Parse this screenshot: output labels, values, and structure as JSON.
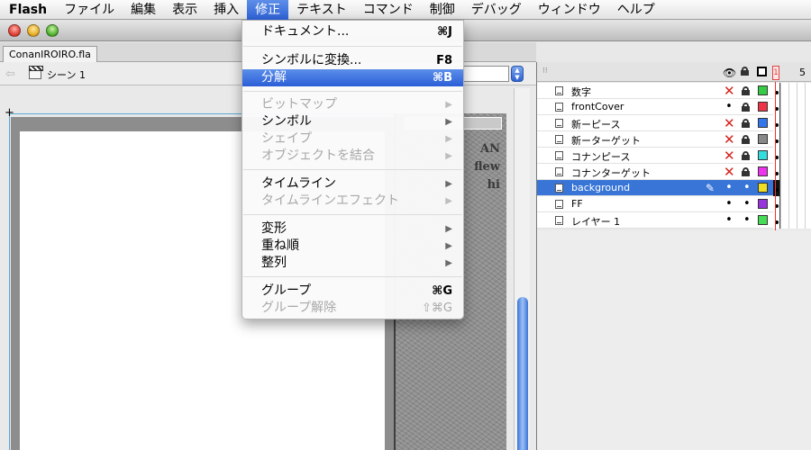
{
  "menubar": {
    "app": "Flash",
    "items": [
      "ファイル",
      "編集",
      "表示",
      "挿入",
      "修正",
      "テキスト",
      "コマンド",
      "制御",
      "デバッグ",
      "ウィンドウ",
      "ヘルプ"
    ],
    "active": "修正"
  },
  "document": {
    "tab": "ConanIROIRO.fla"
  },
  "editbar": {
    "scene": "シーン 1"
  },
  "stage": {
    "cover_text": "AN\nflew\nhi"
  },
  "timeline": {
    "frame_numbers": [
      "1",
      "5"
    ],
    "layers": [
      {
        "name": "数字",
        "visible": "hidden",
        "locked": true,
        "color": "#33cc44"
      },
      {
        "name": "frontCover",
        "visible": "shown",
        "locked": true,
        "color": "#ee3344"
      },
      {
        "name": "新ーピース",
        "visible": "hidden",
        "locked": true,
        "color": "#3377ee"
      },
      {
        "name": "新ーターゲット",
        "visible": "hidden",
        "locked": true,
        "color": "#888888"
      },
      {
        "name": "コナンピース",
        "visible": "hidden",
        "locked": true,
        "color": "#33dddd"
      },
      {
        "name": "コナンターゲット",
        "visible": "hidden",
        "locked": true,
        "color": "#ee33ee"
      },
      {
        "name": "background",
        "visible": "shown",
        "locked": false,
        "color": "#eedd22",
        "selected": true
      },
      {
        "name": "FF",
        "visible": "shown",
        "locked": false,
        "color": "#9933dd"
      },
      {
        "name": "レイヤー 1",
        "visible": "shown",
        "locked": false,
        "color": "#44dd55"
      }
    ]
  },
  "menu": {
    "items": [
      {
        "label": "ドキュメント...",
        "shortcut": "⌘J"
      },
      {
        "label": "シンボルに変換...",
        "shortcut": "F8"
      },
      {
        "label": "分解",
        "shortcut": "⌘B",
        "highlighted": true
      },
      {
        "label": "ビットマップ",
        "submenu": true,
        "disabled": true
      },
      {
        "label": "シンボル",
        "submenu": true
      },
      {
        "label": "シェイプ",
        "submenu": true,
        "disabled": true
      },
      {
        "label": "オブジェクトを結合",
        "submenu": true,
        "disabled": true
      },
      {
        "label": "タイムライン",
        "submenu": true
      },
      {
        "label": "タイムラインエフェクト",
        "submenu": true,
        "disabled": true
      },
      {
        "label": "変形",
        "submenu": true
      },
      {
        "label": "重ね順",
        "submenu": true
      },
      {
        "label": "整列",
        "submenu": true
      },
      {
        "label": "グループ",
        "shortcut": "⌘G"
      },
      {
        "label": "グループ解除",
        "shortcut": "⇧⌘G",
        "disabled": true
      }
    ]
  }
}
